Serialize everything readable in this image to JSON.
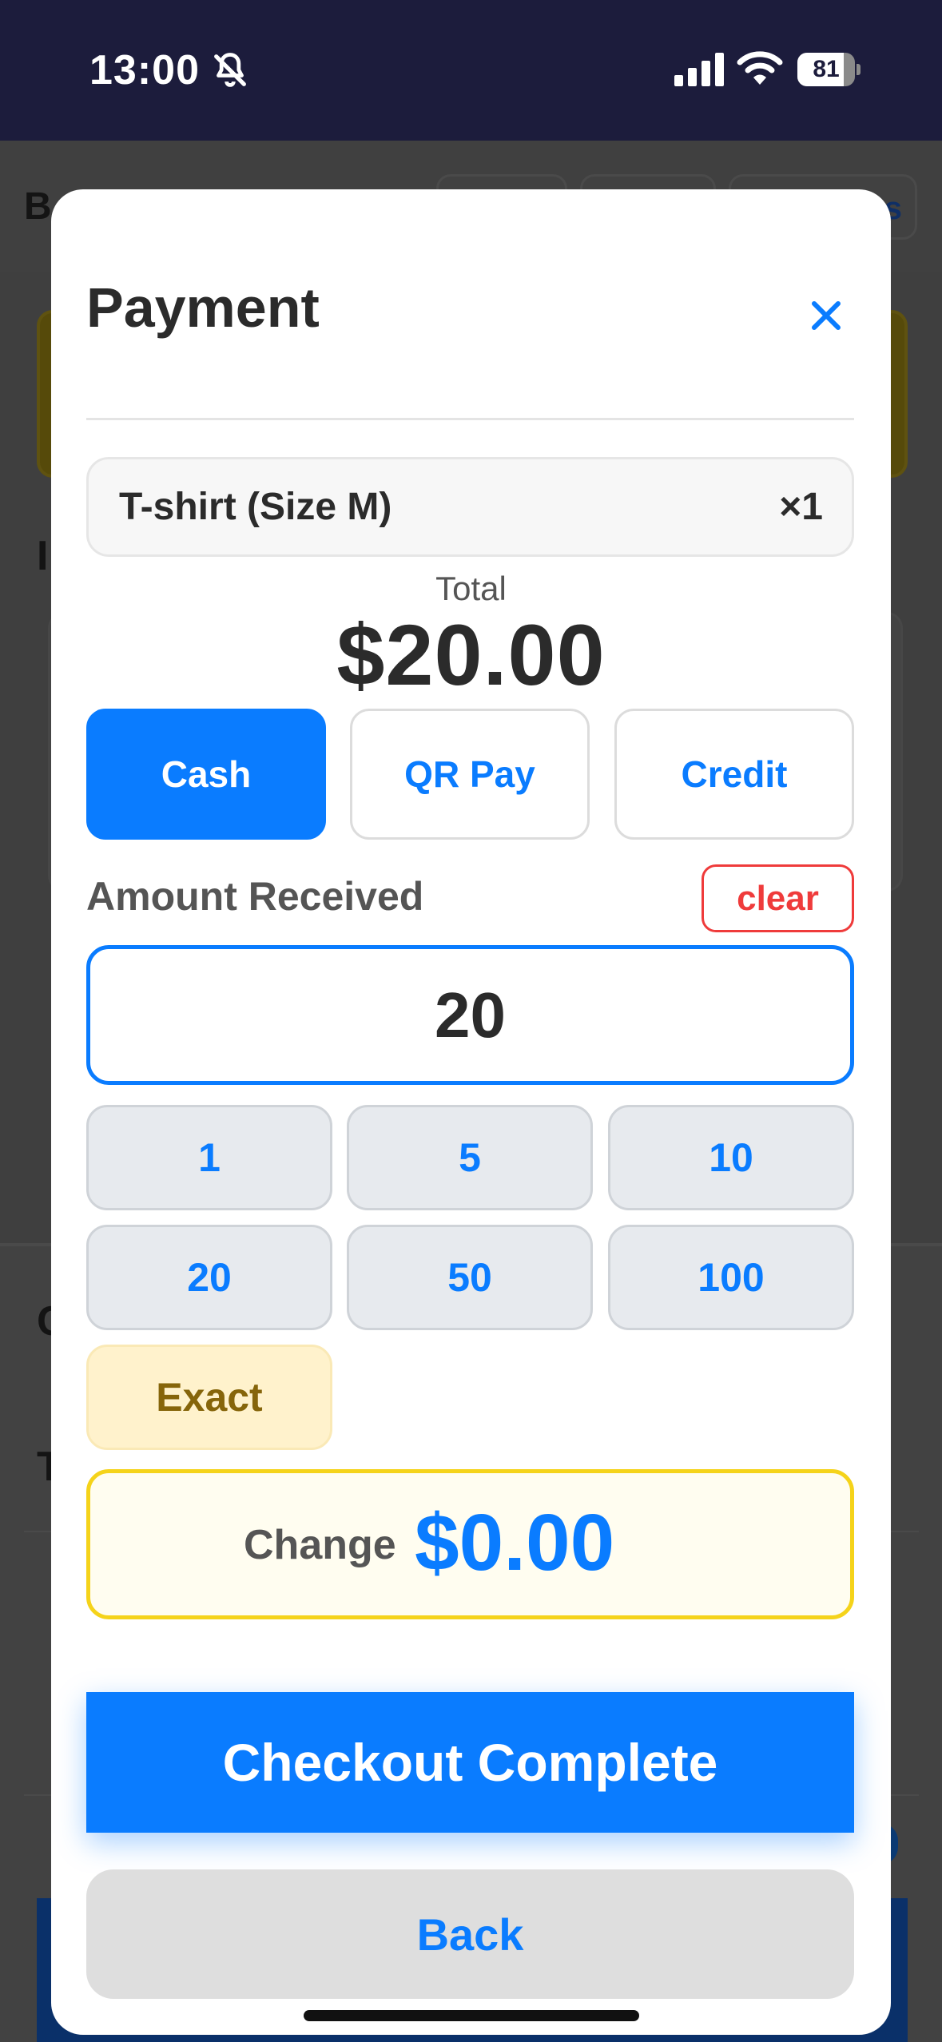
{
  "status_bar": {
    "time": "13:00",
    "battery_level": "81",
    "battery_fraction": 0.81,
    "icons": [
      "bell-slash-icon",
      "cellular-signal-icon",
      "wifi-icon",
      "battery-icon"
    ]
  },
  "background_app": {
    "title_fragment": "B",
    "section_letters": [
      "I",
      "C",
      "T"
    ]
  },
  "modal": {
    "title": "Payment",
    "close_icon": "close-icon",
    "item": {
      "name": "T-shirt (Size M)",
      "quantity": "×1"
    },
    "total_label": "Total",
    "total_value": "$20.00",
    "payment_methods": [
      {
        "label": "Cash",
        "active": true
      },
      {
        "label": "QR Pay",
        "active": false
      },
      {
        "label": "Credit",
        "active": false
      }
    ],
    "amount_label": "Amount Received",
    "clear_label": "clear",
    "amount_value": "20",
    "quick_amounts": [
      "1",
      "5",
      "10",
      "20",
      "50",
      "100"
    ],
    "exact_label": "Exact",
    "change_label": "Change",
    "change_value": "$0.00",
    "checkout_label": "Checkout Complete",
    "back_label": "Back"
  },
  "colors": {
    "primary": "#0a7cff",
    "danger": "#ef3b3b",
    "highlight_border": "#f5d31a",
    "status_bar_bg": "#1c1c3c"
  }
}
